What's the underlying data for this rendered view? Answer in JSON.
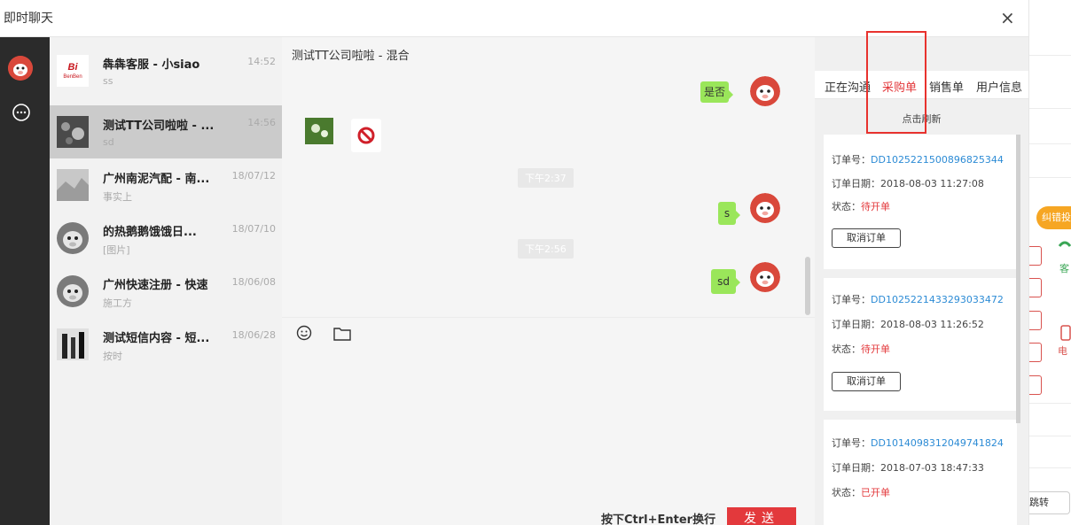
{
  "window": {
    "title": "即时聊天",
    "close_label": "×"
  },
  "sidebar": {
    "icons": [
      "avatar",
      "chat-bubble-icon"
    ]
  },
  "conversations": [
    {
      "name": "犇犇客服 - 小siao",
      "time": "14:52",
      "preview": "ss",
      "thumb": "benben-logo"
    },
    {
      "name": "测试TT公司啦啦 - ...",
      "time": "14:56",
      "preview": "sd",
      "thumb": "flower-photo"
    },
    {
      "name": "广州南泥汽配 - 南...",
      "time": "18/07/12",
      "preview": "事实上",
      "thumb": "gray-photo"
    },
    {
      "name": "的热鹅鹅饿饿日...",
      "time": "18/07/10",
      "preview": "[图片]",
      "thumb": "cow-avatar"
    },
    {
      "name": "广州快速注册 - 快速",
      "time": "18/06/08",
      "preview": "施工方",
      "thumb": "cow-avatar"
    },
    {
      "name": "测试短信内容 - 短...",
      "time": "18/06/28",
      "preview": "按时",
      "thumb": "bw-photo"
    }
  ],
  "chat": {
    "title": "测试TT公司啦啦 - 混合",
    "messages": [
      {
        "type": "text",
        "text": "是否"
      },
      {
        "type": "image-blocked"
      },
      {
        "type": "timestamp",
        "text": "下午2:37"
      },
      {
        "type": "text",
        "text": "s"
      },
      {
        "type": "timestamp",
        "text": "下午2:56"
      },
      {
        "type": "text",
        "text": "sd"
      }
    ],
    "hint": "按下Ctrl+Enter换行",
    "send_label": "发送"
  },
  "panel": {
    "tabs": [
      "正在沟通",
      "采购单",
      "销售单",
      "用户信息"
    ],
    "active_tab": "采购单",
    "refresh_label": "点击刷新",
    "orders": [
      {
        "no_label": "订单号：",
        "no": "DD1025221500896825344",
        "date_label": "订单日期：",
        "date": "2018-08-03 11:27:08",
        "status_label": "状态：",
        "status": "待开单",
        "action": "取消订单"
      },
      {
        "no_label": "订单号：",
        "no": "DD1025221433293033472",
        "date_label": "订单日期：",
        "date": "2018-08-03 11:26:52",
        "status_label": "状态：",
        "status": "待开单",
        "action": "取消订单"
      },
      {
        "no_label": "订单号：",
        "no": "DD1014098312049741824",
        "date_label": "订单日期：",
        "date": "2018-07-03 18:47:33",
        "status_label": "状态：",
        "status": "已开单",
        "action": ""
      }
    ]
  },
  "background_page": {
    "badge": "纠错投",
    "label_1": "客",
    "label_2": "电",
    "jump": "跳转"
  },
  "colors": {
    "accent": "#e3393c",
    "bubble": "#9ae65a",
    "link": "#2c8bd5",
    "highlight_box": "#e8322e"
  }
}
